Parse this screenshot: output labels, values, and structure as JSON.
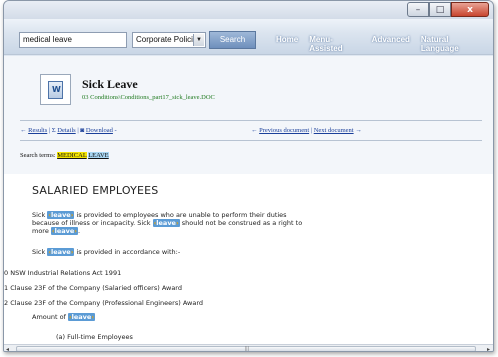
{
  "window": {
    "controls": {
      "minimize": "–",
      "maximize": "□",
      "close": "x"
    }
  },
  "navbar": {
    "search_value": "medical leave",
    "collection_selected": "Corporate Policies",
    "search_button": "Search",
    "links": [
      "Home",
      "Menu-Assisted",
      "Advanced",
      "Natural Language"
    ]
  },
  "document": {
    "title": "Sick Leave",
    "filename": "03 Conditions\\Conditions_part17_sick_leave.DOC",
    "nav": {
      "results": "Results",
      "details": "Details",
      "download": "Download",
      "previous": "Previous document",
      "separator": "|",
      "next": "Next document"
    },
    "search_terms_label": "Search terms:",
    "search_terms": [
      "MEDICAL",
      "LEAVE"
    ]
  },
  "content": {
    "heading": "SALARIED EMPLOYEES",
    "hit_word": "leave",
    "para1": {
      "a": "Sick",
      "b": "is provided to employees who are unable to perform their duties",
      "c": "because of illness or incapacity. Sick",
      "d": "should not be construed as a right to",
      "e": "more"
    },
    "para2": {
      "a": "Sick",
      "b": "is provided in accordance with:-"
    },
    "items": [
      "0 NSW Industrial Relations Act 1991",
      "1 Clause 23F of the Company (Salaried officers) Award",
      "2 Clause 23F of the Company (Professional Engineers) Award"
    ],
    "amount_label": "Amount of",
    "sub_item": "(a) Full-time Employees"
  },
  "scrollbar": {
    "left": "◂",
    "right": "▸",
    "grip": "|||"
  }
}
